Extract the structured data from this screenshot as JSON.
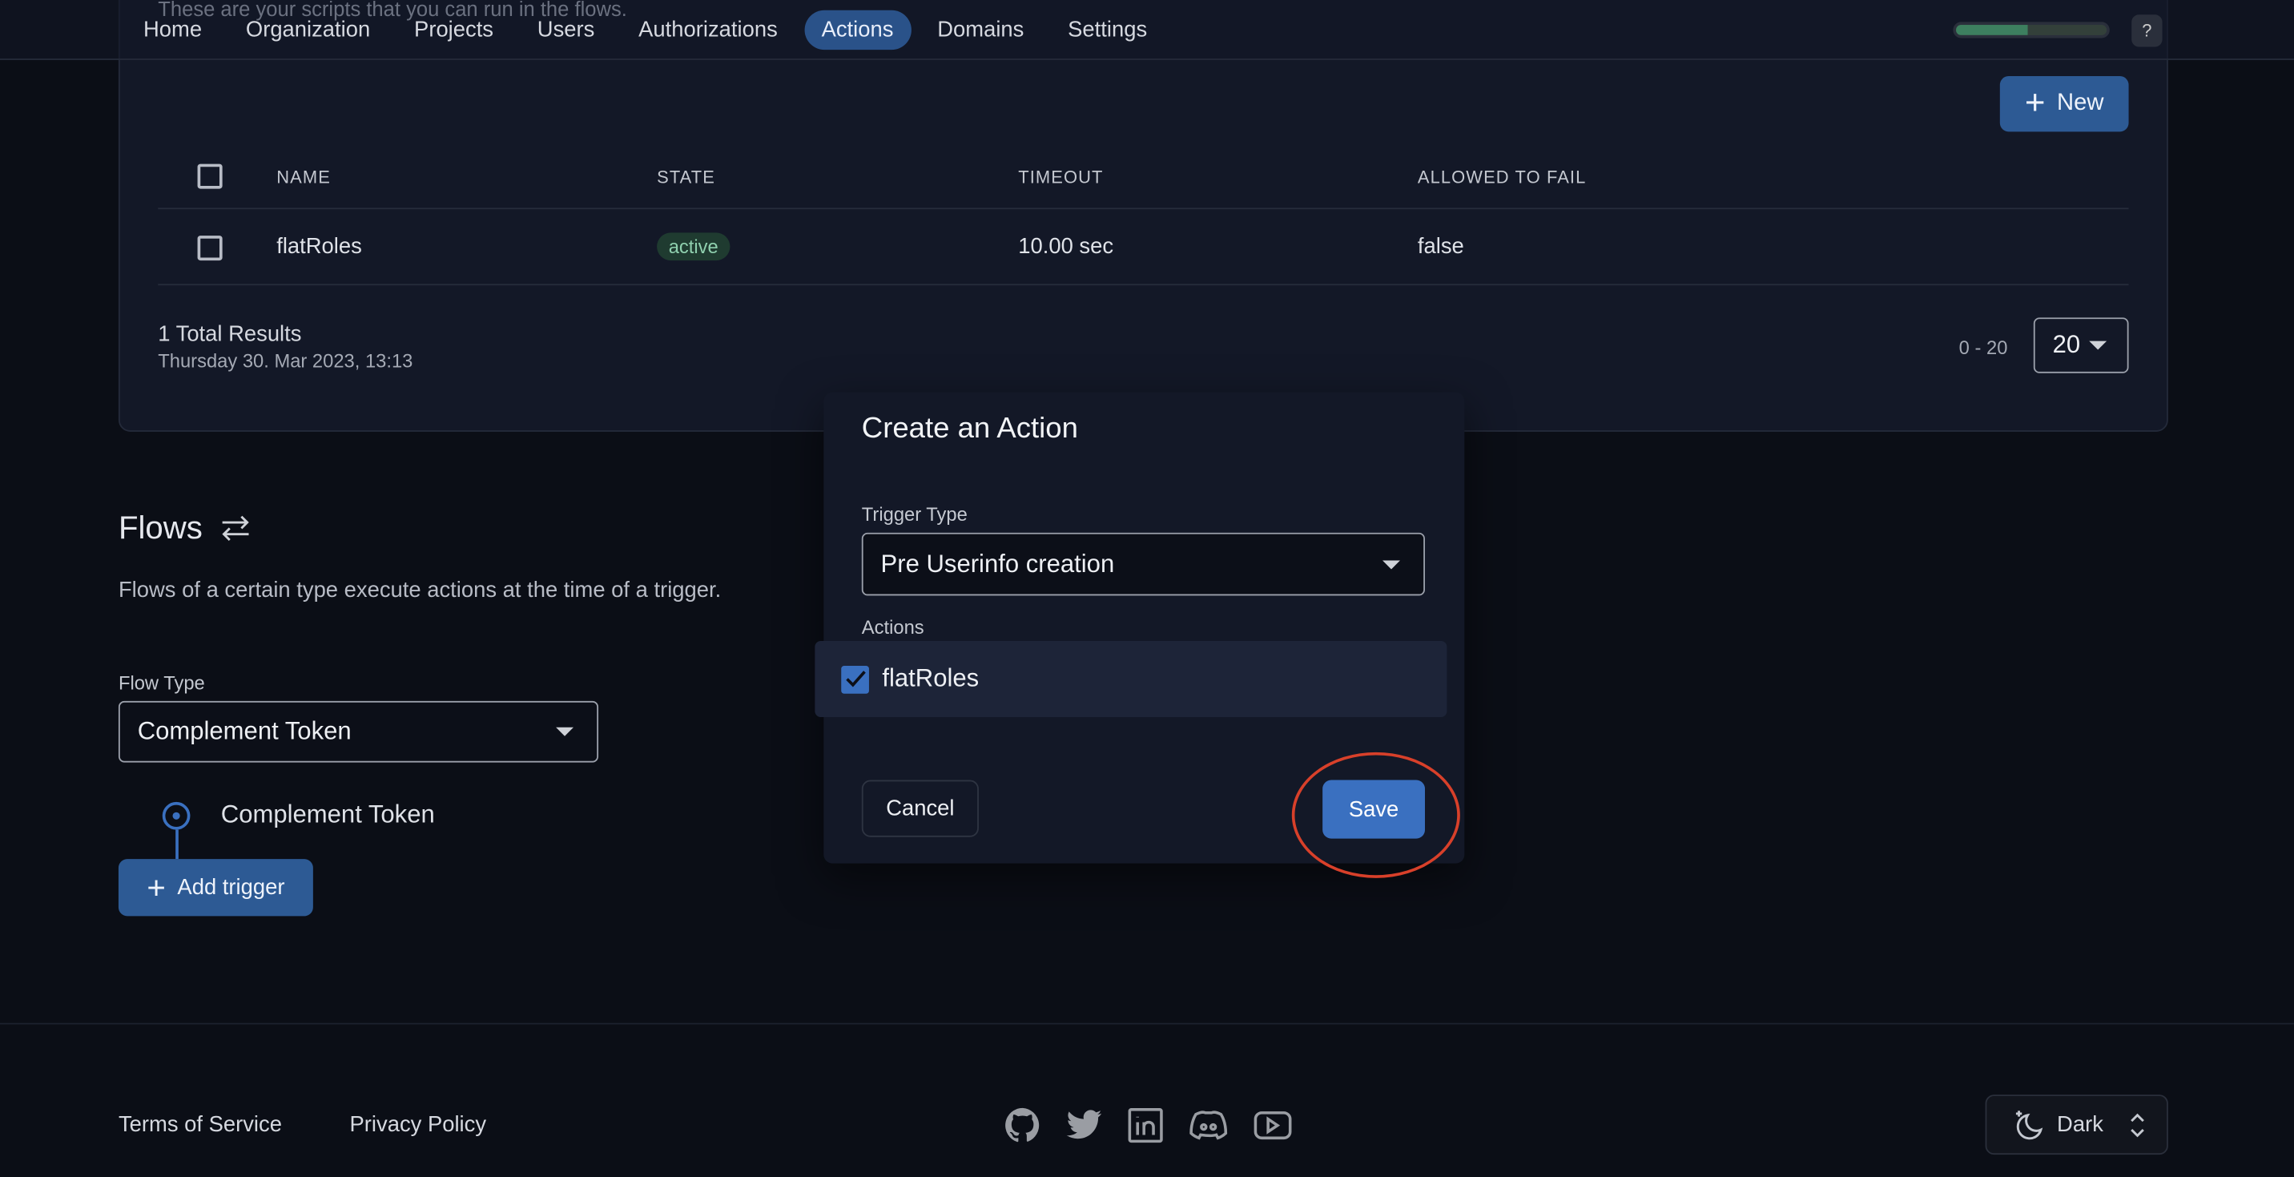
{
  "header": {
    "subtitle": "These are your scripts that you can run in the flows.",
    "nav": [
      "Home",
      "Organization",
      "Projects",
      "Users",
      "Authorizations",
      "Actions",
      "Domains",
      "Settings"
    ],
    "active_nav": "Actions",
    "progress_percent": 48,
    "help_label": "?"
  },
  "actions_table": {
    "new_button": "New",
    "columns": [
      "NAME",
      "STATE",
      "TIMEOUT",
      "ALLOWED TO FAIL"
    ],
    "rows": [
      {
        "name": "flatRoles",
        "state": "active",
        "timeout": "10.00 sec",
        "allowed_to_fail": "false"
      }
    ],
    "total_results": "1 Total Results",
    "timestamp": "Thursday 30. Mar 2023, 13:13",
    "range": "0 - 20",
    "page_size": "20"
  },
  "flows": {
    "title": "Flows",
    "description": "Flows of a certain type execute actions at the time of a trigger.",
    "flow_type_label": "Flow Type",
    "flow_type_value": "Complement Token",
    "node_label": "Complement Token",
    "add_trigger": "Add trigger"
  },
  "dialog": {
    "title": "Create an Action",
    "trigger_type_label": "Trigger Type",
    "trigger_type_value": "Pre Userinfo creation",
    "actions_label": "Actions",
    "actions": [
      {
        "name": "flatRoles",
        "checked": true
      }
    ],
    "cancel": "Cancel",
    "save": "Save"
  },
  "footer": {
    "terms": "Terms of Service",
    "privacy": "Privacy Policy",
    "social_icons": [
      "github-icon",
      "twitter-icon",
      "linkedin-icon",
      "discord-icon",
      "youtube-icon"
    ],
    "theme": "Dark"
  },
  "colors": {
    "accent": "#2d5a94",
    "save": "#3a70c0",
    "highlight_ring": "#d8402a",
    "background": "#0b0e16"
  }
}
